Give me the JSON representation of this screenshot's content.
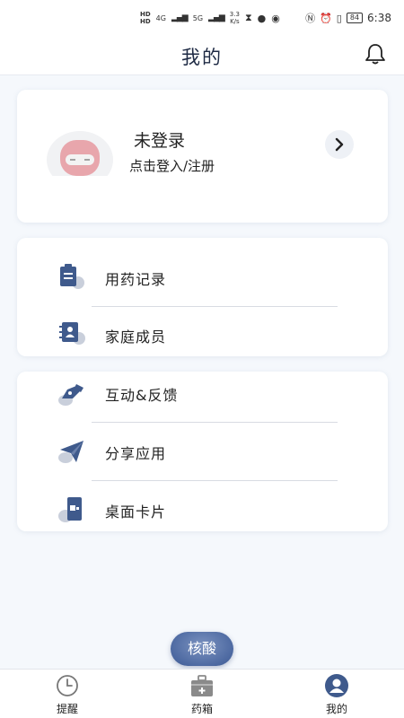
{
  "status_bar": {
    "hd1": "HD",
    "hd2": "HD",
    "net1": "4G",
    "net2": "5G",
    "speed_value": "3.3",
    "speed_unit": "K/s",
    "battery": "84",
    "time": "6:38"
  },
  "header": {
    "title": "我的"
  },
  "profile": {
    "name": "未登录",
    "subtitle": "点击登入/注册"
  },
  "menu_group_1": [
    {
      "label": "用药记录",
      "icon": "clipboard-icon"
    },
    {
      "label": "家庭成员",
      "icon": "contacts-book-icon"
    }
  ],
  "menu_group_2": [
    {
      "label": "互动&反馈",
      "icon": "pen-feedback-icon"
    },
    {
      "label": "分享应用",
      "icon": "paper-plane-icon"
    },
    {
      "label": "桌面卡片",
      "icon": "phone-card-icon"
    }
  ],
  "fab": {
    "label": "核酸"
  },
  "bottom_nav": [
    {
      "label": "提醒",
      "icon": "clock-icon",
      "active": false
    },
    {
      "label": "药箱",
      "icon": "medicine-box-icon",
      "active": false
    },
    {
      "label": "我的",
      "icon": "user-icon",
      "active": true
    }
  ],
  "colors": {
    "accent": "#3f5a8c",
    "background": "#f5f8fc",
    "card": "#ffffff"
  }
}
